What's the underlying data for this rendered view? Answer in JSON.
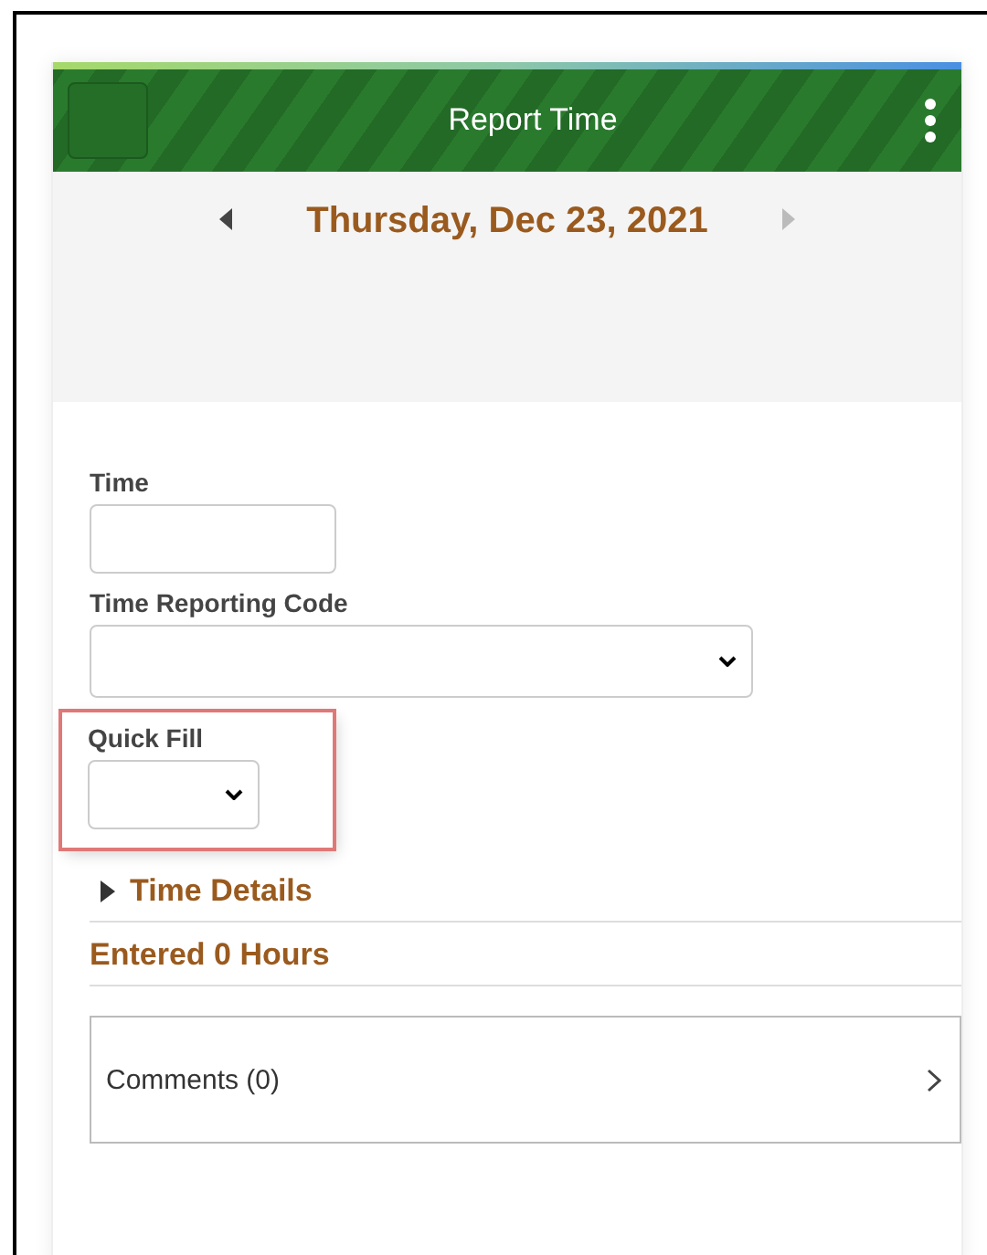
{
  "header": {
    "title": "Report Time"
  },
  "date_nav": {
    "date": "Thursday, Dec 23, 2021",
    "prev_disabled": false,
    "next_disabled": true
  },
  "fields": [
    {
      "kind": "text",
      "label": "Time",
      "highlighted": false
    },
    {
      "kind": "select",
      "label": "Time Reporting Code",
      "highlighted": false
    },
    {
      "kind": "select-small",
      "label": "Quick Fill",
      "highlighted": true
    }
  ],
  "time_details": {
    "label": "Time Details",
    "expanded": false
  },
  "entered": "Entered 0 Hours",
  "comments": {
    "label": "Comments (0)"
  }
}
